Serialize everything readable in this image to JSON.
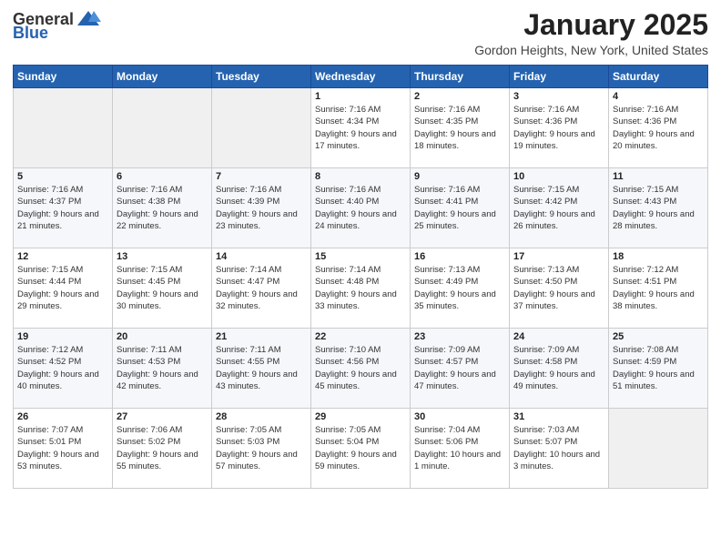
{
  "header": {
    "logo_general": "General",
    "logo_blue": "Blue",
    "month": "January 2025",
    "location": "Gordon Heights, New York, United States"
  },
  "days_of_week": [
    "Sunday",
    "Monday",
    "Tuesday",
    "Wednesday",
    "Thursday",
    "Friday",
    "Saturday"
  ],
  "weeks": [
    [
      {
        "day": "",
        "sunrise": "",
        "sunset": "",
        "daylight": "",
        "empty": true
      },
      {
        "day": "",
        "sunrise": "",
        "sunset": "",
        "daylight": "",
        "empty": true
      },
      {
        "day": "",
        "sunrise": "",
        "sunset": "",
        "daylight": "",
        "empty": true
      },
      {
        "day": "1",
        "sunrise": "Sunrise: 7:16 AM",
        "sunset": "Sunset: 4:34 PM",
        "daylight": "Daylight: 9 hours and 17 minutes."
      },
      {
        "day": "2",
        "sunrise": "Sunrise: 7:16 AM",
        "sunset": "Sunset: 4:35 PM",
        "daylight": "Daylight: 9 hours and 18 minutes."
      },
      {
        "day": "3",
        "sunrise": "Sunrise: 7:16 AM",
        "sunset": "Sunset: 4:36 PM",
        "daylight": "Daylight: 9 hours and 19 minutes."
      },
      {
        "day": "4",
        "sunrise": "Sunrise: 7:16 AM",
        "sunset": "Sunset: 4:36 PM",
        "daylight": "Daylight: 9 hours and 20 minutes."
      }
    ],
    [
      {
        "day": "5",
        "sunrise": "Sunrise: 7:16 AM",
        "sunset": "Sunset: 4:37 PM",
        "daylight": "Daylight: 9 hours and 21 minutes."
      },
      {
        "day": "6",
        "sunrise": "Sunrise: 7:16 AM",
        "sunset": "Sunset: 4:38 PM",
        "daylight": "Daylight: 9 hours and 22 minutes."
      },
      {
        "day": "7",
        "sunrise": "Sunrise: 7:16 AM",
        "sunset": "Sunset: 4:39 PM",
        "daylight": "Daylight: 9 hours and 23 minutes."
      },
      {
        "day": "8",
        "sunrise": "Sunrise: 7:16 AM",
        "sunset": "Sunset: 4:40 PM",
        "daylight": "Daylight: 9 hours and 24 minutes."
      },
      {
        "day": "9",
        "sunrise": "Sunrise: 7:16 AM",
        "sunset": "Sunset: 4:41 PM",
        "daylight": "Daylight: 9 hours and 25 minutes."
      },
      {
        "day": "10",
        "sunrise": "Sunrise: 7:15 AM",
        "sunset": "Sunset: 4:42 PM",
        "daylight": "Daylight: 9 hours and 26 minutes."
      },
      {
        "day": "11",
        "sunrise": "Sunrise: 7:15 AM",
        "sunset": "Sunset: 4:43 PM",
        "daylight": "Daylight: 9 hours and 28 minutes."
      }
    ],
    [
      {
        "day": "12",
        "sunrise": "Sunrise: 7:15 AM",
        "sunset": "Sunset: 4:44 PM",
        "daylight": "Daylight: 9 hours and 29 minutes."
      },
      {
        "day": "13",
        "sunrise": "Sunrise: 7:15 AM",
        "sunset": "Sunset: 4:45 PM",
        "daylight": "Daylight: 9 hours and 30 minutes."
      },
      {
        "day": "14",
        "sunrise": "Sunrise: 7:14 AM",
        "sunset": "Sunset: 4:47 PM",
        "daylight": "Daylight: 9 hours and 32 minutes."
      },
      {
        "day": "15",
        "sunrise": "Sunrise: 7:14 AM",
        "sunset": "Sunset: 4:48 PM",
        "daylight": "Daylight: 9 hours and 33 minutes."
      },
      {
        "day": "16",
        "sunrise": "Sunrise: 7:13 AM",
        "sunset": "Sunset: 4:49 PM",
        "daylight": "Daylight: 9 hours and 35 minutes."
      },
      {
        "day": "17",
        "sunrise": "Sunrise: 7:13 AM",
        "sunset": "Sunset: 4:50 PM",
        "daylight": "Daylight: 9 hours and 37 minutes."
      },
      {
        "day": "18",
        "sunrise": "Sunrise: 7:12 AM",
        "sunset": "Sunset: 4:51 PM",
        "daylight": "Daylight: 9 hours and 38 minutes."
      }
    ],
    [
      {
        "day": "19",
        "sunrise": "Sunrise: 7:12 AM",
        "sunset": "Sunset: 4:52 PM",
        "daylight": "Daylight: 9 hours and 40 minutes."
      },
      {
        "day": "20",
        "sunrise": "Sunrise: 7:11 AM",
        "sunset": "Sunset: 4:53 PM",
        "daylight": "Daylight: 9 hours and 42 minutes."
      },
      {
        "day": "21",
        "sunrise": "Sunrise: 7:11 AM",
        "sunset": "Sunset: 4:55 PM",
        "daylight": "Daylight: 9 hours and 43 minutes."
      },
      {
        "day": "22",
        "sunrise": "Sunrise: 7:10 AM",
        "sunset": "Sunset: 4:56 PM",
        "daylight": "Daylight: 9 hours and 45 minutes."
      },
      {
        "day": "23",
        "sunrise": "Sunrise: 7:09 AM",
        "sunset": "Sunset: 4:57 PM",
        "daylight": "Daylight: 9 hours and 47 minutes."
      },
      {
        "day": "24",
        "sunrise": "Sunrise: 7:09 AM",
        "sunset": "Sunset: 4:58 PM",
        "daylight": "Daylight: 9 hours and 49 minutes."
      },
      {
        "day": "25",
        "sunrise": "Sunrise: 7:08 AM",
        "sunset": "Sunset: 4:59 PM",
        "daylight": "Daylight: 9 hours and 51 minutes."
      }
    ],
    [
      {
        "day": "26",
        "sunrise": "Sunrise: 7:07 AM",
        "sunset": "Sunset: 5:01 PM",
        "daylight": "Daylight: 9 hours and 53 minutes."
      },
      {
        "day": "27",
        "sunrise": "Sunrise: 7:06 AM",
        "sunset": "Sunset: 5:02 PM",
        "daylight": "Daylight: 9 hours and 55 minutes."
      },
      {
        "day": "28",
        "sunrise": "Sunrise: 7:05 AM",
        "sunset": "Sunset: 5:03 PM",
        "daylight": "Daylight: 9 hours and 57 minutes."
      },
      {
        "day": "29",
        "sunrise": "Sunrise: 7:05 AM",
        "sunset": "Sunset: 5:04 PM",
        "daylight": "Daylight: 9 hours and 59 minutes."
      },
      {
        "day": "30",
        "sunrise": "Sunrise: 7:04 AM",
        "sunset": "Sunset: 5:06 PM",
        "daylight": "Daylight: 10 hours and 1 minute."
      },
      {
        "day": "31",
        "sunrise": "Sunrise: 7:03 AM",
        "sunset": "Sunset: 5:07 PM",
        "daylight": "Daylight: 10 hours and 3 minutes."
      },
      {
        "day": "",
        "sunrise": "",
        "sunset": "",
        "daylight": "",
        "empty": true
      }
    ]
  ]
}
